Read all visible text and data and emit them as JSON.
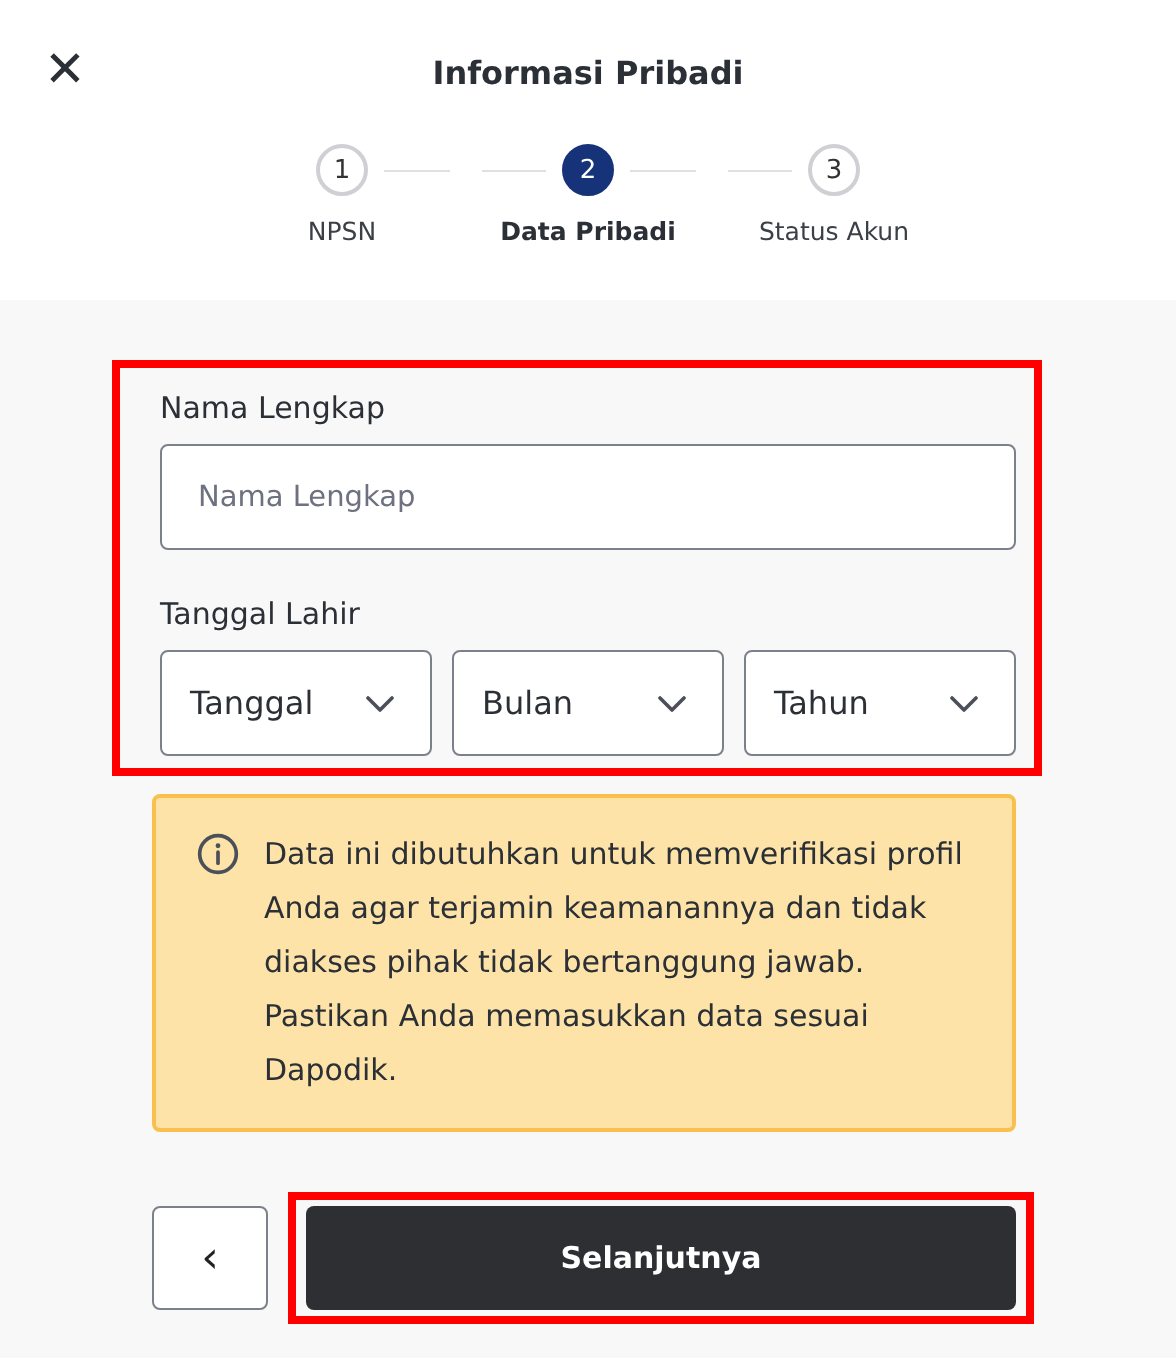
{
  "header": {
    "close_icon": "✕",
    "title": "Informasi Pribadi"
  },
  "steps": [
    {
      "number": "1",
      "label": "NPSN",
      "selected": false
    },
    {
      "number": "2",
      "label": "Data Pribadi",
      "selected": true
    },
    {
      "number": "3",
      "label": "Status Akun",
      "selected": false
    }
  ],
  "form": {
    "highlighted": true,
    "name_label": "Nama Lengkap",
    "name_placeholder": "Nama Lengkap",
    "birth_label": "Tanggal Lahir",
    "selects": [
      {
        "placeholder": "Tanggal"
      },
      {
        "placeholder": "Bulan"
      },
      {
        "placeholder": "Tahun"
      }
    ]
  },
  "notice": "Data ini dibutuhkan untuk memverifikasi profil Anda agar terjamin keamanannya dan tidak diakses pihak tidak bertanggung jawab. Pastikan Anda memasukkan data sesuai Dapodik.",
  "back_button": {
    "label": "‹"
  },
  "next_button": {
    "label": "Selanjutnya",
    "highlighted": true
  }
}
